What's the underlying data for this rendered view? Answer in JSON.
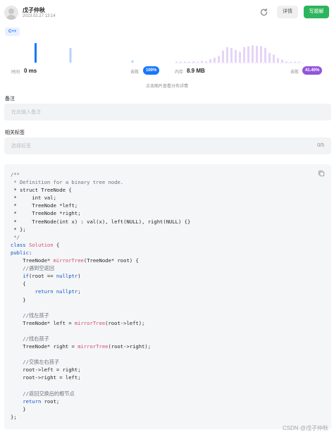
{
  "header": {
    "user_name": "戊子仲秋",
    "post_date": "2023.02.27 13:14",
    "refresh_icon": "refresh-icon",
    "detail_label": "详情",
    "write_label": "写题解"
  },
  "language_tag": "C++",
  "performance": {
    "time_label": "时间",
    "time_value": "0 ms",
    "time_beats_label": "击败",
    "time_beats_value": "100%",
    "memory_label": "内存",
    "memory_value": "8.9 MB",
    "memory_beats_label": "击败",
    "memory_beats_value": "41.40%",
    "hint": "点击图片查看分布详情",
    "colors": {
      "time_bar": "#1677ff",
      "time_bar_light": "#b3d4ff",
      "memory_bar": "#9254de",
      "memory_bar_light": "#e6d4f7"
    },
    "time_distribution": [
      0,
      0,
      1.0,
      0,
      0,
      0,
      0,
      0,
      0,
      0,
      0,
      0.75,
      0,
      0,
      0,
      0,
      0,
      0,
      0,
      0,
      0,
      0,
      0,
      0,
      0,
      0,
      0,
      0.12
    ],
    "memory_distribution": [
      0.04,
      0.05,
      0.06,
      0.04,
      0.08,
      0.06,
      0.1,
      0.08,
      0.18,
      0.26,
      0.35,
      0.62,
      0.8,
      0.75,
      0.65,
      0.56,
      0.8,
      0.84,
      0.88,
      0.86,
      0.85,
      0.76,
      0.5,
      0.42,
      0.24,
      0.16,
      0.08,
      0.05,
      0.04,
      0.03
    ]
  },
  "note": {
    "label": "备注",
    "placeholder": "在此输入备注"
  },
  "tags": {
    "label": "相关标签",
    "placeholder": "选择标签",
    "counter": "0/5"
  },
  "code": {
    "copy_icon": "copy-icon",
    "lines": [
      [
        [
          "c-cm",
          "/**"
        ]
      ],
      [
        [
          "c-cm",
          " * Definition for a binary tree node."
        ]
      ],
      [
        [
          "",
          " * struct TreeNode {"
        ]
      ],
      [
        [
          "",
          " *     int val;"
        ]
      ],
      [
        [
          "",
          " *     TreeNode *left;"
        ]
      ],
      [
        [
          "",
          " *     TreeNode *right;"
        ]
      ],
      [
        [
          "",
          " *     TreeNode(int x) : val(x), left(NULL), right(NULL) {}"
        ]
      ],
      [
        [
          "",
          " * };"
        ]
      ],
      [
        [
          "c-cm",
          " */"
        ]
      ],
      [
        [
          "c-kw",
          "class "
        ],
        [
          "c-fn",
          "Solution"
        ],
        [
          "",
          " {"
        ]
      ],
      [
        [
          "c-kw",
          "public"
        ],
        [
          "",
          ":"
        ]
      ],
      [
        [
          "",
          "    TreeNode* "
        ],
        [
          "c-fn",
          "mirrorTree"
        ],
        [
          "",
          "(TreeNode* root) {"
        ]
      ],
      [
        [
          "c-cm",
          "    //遇到空返回"
        ]
      ],
      [
        [
          "",
          "    "
        ],
        [
          "c-kw",
          "if"
        ],
        [
          "",
          "(root == "
        ],
        [
          "c-co",
          "nullptr"
        ],
        [
          "",
          ")"
        ]
      ],
      [
        [
          "",
          "    {"
        ]
      ],
      [
        [
          "",
          "        "
        ],
        [
          "c-kw",
          "return "
        ],
        [
          "c-co",
          "nullptr"
        ],
        [
          "",
          ";"
        ]
      ],
      [
        [
          "",
          "    }"
        ]
      ],
      [
        [
          "",
          ""
        ]
      ],
      [
        [
          "c-cm",
          "    //找左孩子"
        ]
      ],
      [
        [
          "",
          "    TreeNode* left = "
        ],
        [
          "c-fn",
          "mirrorTree"
        ],
        [
          "",
          "(root->left);"
        ]
      ],
      [
        [
          "",
          ""
        ]
      ],
      [
        [
          "c-cm",
          "    //找右孩子"
        ]
      ],
      [
        [
          "",
          "    TreeNode* right = "
        ],
        [
          "c-fn",
          "mirrorTree"
        ],
        [
          "",
          "(root->right);"
        ]
      ],
      [
        [
          "",
          ""
        ]
      ],
      [
        [
          "c-cm",
          "    //交换左右孩子"
        ]
      ],
      [
        [
          "",
          "    root->left = right;"
        ]
      ],
      [
        [
          "",
          "    root->right = left;"
        ]
      ],
      [
        [
          "",
          ""
        ]
      ],
      [
        [
          "c-cm",
          "    //返回交换后的根节点"
        ]
      ],
      [
        [
          "",
          "    "
        ],
        [
          "c-kw",
          "return "
        ],
        [
          "",
          "root;"
        ]
      ],
      [
        [
          "",
          "    }"
        ]
      ],
      [
        [
          "",
          "};"
        ]
      ]
    ]
  },
  "watermark": "CSDN @戊子仲秋"
}
